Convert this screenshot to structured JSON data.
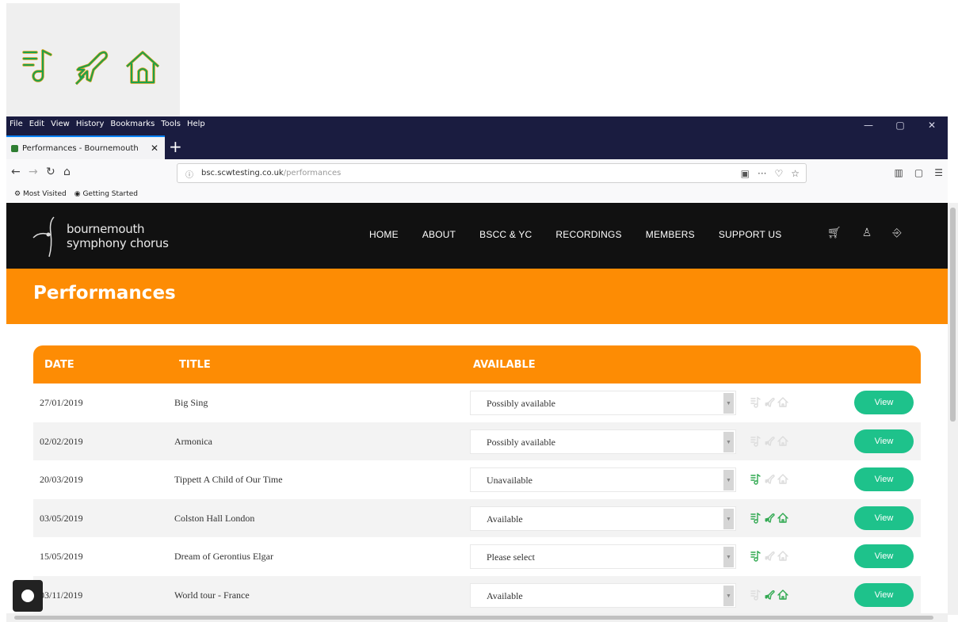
{
  "legend": {
    "icons": [
      "music-note-icon",
      "plane-icon",
      "home-icon"
    ],
    "color_fill": "#1ea04a",
    "color_outline": "#d4a017"
  },
  "browser": {
    "menu": [
      "File",
      "Edit",
      "View",
      "History",
      "Bookmarks",
      "Tools",
      "Help"
    ],
    "window_controls": [
      "—",
      "▢",
      "✕"
    ],
    "tab_title": "Performances - Bournemouth",
    "tab_close": "✕",
    "new_tab": "+",
    "url_host": "bsc.scwtesting.co.uk",
    "url_path": "/performances",
    "url_actions": [
      "▣",
      "···",
      "♡",
      "☆"
    ],
    "right_tools": [
      "▥",
      "▢",
      "☰"
    ],
    "bookmarks": [
      "Most Visited",
      "Getting Started"
    ]
  },
  "site": {
    "logo_line1": "bournemouth",
    "logo_line2": "symphony chorus",
    "nav": [
      "HOME",
      "ABOUT",
      "BSCC & YC",
      "RECORDINGS",
      "MEMBERS",
      "SUPPORT US"
    ],
    "header_icons": [
      "cart-icon",
      "user-icon",
      "logout-icon"
    ],
    "page_title": "Performances"
  },
  "table": {
    "headers": {
      "date": "DATE",
      "title": "TITLE",
      "available": "AVAILABLE"
    },
    "view_label": "View",
    "dropdown_symbol": "▼",
    "rows": [
      {
        "date": "27/01/2019",
        "title": "Big Sing",
        "available": "Possibly available",
        "status": [
          0,
          0,
          0
        ]
      },
      {
        "date": "02/02/2019",
        "title": "Armonica",
        "available": "Possibly available",
        "status": [
          0,
          0,
          0
        ]
      },
      {
        "date": "20/03/2019",
        "title": "Tippett A Child of Our Time",
        "available": "Unavailable",
        "status": [
          1,
          0,
          0
        ]
      },
      {
        "date": "03/05/2019",
        "title": "Colston Hall London",
        "available": "Available",
        "status": [
          1,
          1,
          1
        ]
      },
      {
        "date": "15/05/2019",
        "title": "Dream of Gerontius Elgar",
        "available": "Please select",
        "status": [
          1,
          0,
          0
        ]
      },
      {
        "date": "03/11/2019",
        "title": "World tour - France",
        "available": "Available",
        "status": [
          0,
          1,
          1
        ]
      }
    ]
  },
  "colors": {
    "orange": "#fd8c04",
    "navy": "#1a1c40",
    "green_button": "#1ec28b",
    "status_active": "#2ea84f",
    "status_inactive": "#dcdcdc"
  }
}
